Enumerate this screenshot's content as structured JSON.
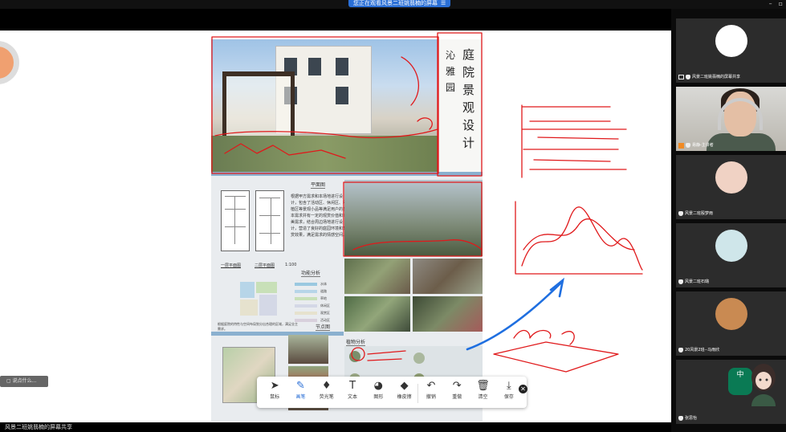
{
  "banner": {
    "text": "您正在观看风景二班姚翡楠的屏幕",
    "menu": "☰"
  },
  "window": {
    "minimize": "–",
    "restore": "▫"
  },
  "stage": {
    "comment": "说点什么...",
    "comment_icon": "comment-icon"
  },
  "poster": {
    "title": "庭院景观设计",
    "subtitle": "沁雅园",
    "sections": {
      "plan": "平面图",
      "function": "功能分析",
      "node": "节点图",
      "plant": "植物分析"
    },
    "plan_labels": [
      "一层平面图",
      "二层平面图"
    ],
    "plan_scale": "1:100",
    "design_text": "根据甲方需求和本场地进行设计，包含了活动区、休闲区、种植区等景观小品等满足用户的基本需求并有一定的观赏价值和审美需求，结合周边场地进行设计，营造了良好的庭园环境和观赏效果，满足需求的情感空间。",
    "legend": [
      {
        "label": "水体",
        "color": "#9ac8e0"
      },
      {
        "label": "道路",
        "color": "#b7d5e8"
      },
      {
        "label": "草地",
        "color": "#c8e0b8"
      },
      {
        "label": "休闲区",
        "color": "#d4d8e6"
      },
      {
        "label": "观赏区",
        "color": "#e6e2ce"
      },
      {
        "label": "活动区",
        "color": "#d8d0dc"
      }
    ],
    "small_note": "根据庭院的特性与空间布局划分出合理的区域，满足业主需求。"
  },
  "toolbar": {
    "tools": [
      {
        "label": "鼠标",
        "icon": "cursor-icon",
        "glyph": "➤"
      },
      {
        "label": "画笔",
        "icon": "pen-icon",
        "glyph": "✎"
      },
      {
        "label": "荧光笔",
        "icon": "highlighter-icon",
        "glyph": "♦"
      },
      {
        "label": "文本",
        "icon": "text-icon",
        "glyph": "T"
      },
      {
        "label": "图形",
        "icon": "shape-icon",
        "glyph": "◕"
      },
      {
        "label": "橡皮擦",
        "icon": "eraser-icon",
        "glyph": "◆"
      },
      {
        "label": "撤销",
        "icon": "undo-icon",
        "glyph": "↶"
      },
      {
        "label": "重做",
        "icon": "redo-icon",
        "glyph": "↷"
      },
      {
        "label": "清空",
        "icon": "trash-icon",
        "glyph": "🗑"
      },
      {
        "label": "保存",
        "icon": "save-icon",
        "glyph": "⤓"
      }
    ],
    "close": "✕"
  },
  "status": "风景二班姚翡楠的屏幕共享",
  "participants": [
    {
      "name": "风景二班姚翡楠的屏幕共享",
      "type": "avatar"
    },
    {
      "name": "易静-主讲者",
      "type": "video"
    },
    {
      "name": "风景二班殷梦雨",
      "type": "avatar"
    },
    {
      "name": "风景二班石璐",
      "type": "avatar"
    },
    {
      "name": "20风景2班--马雨欣",
      "type": "avatar"
    },
    {
      "name": "张思怡",
      "type": "avatar"
    }
  ],
  "ime": {
    "label": "中"
  },
  "colors": {
    "accent": "#2a6fd6",
    "ink": "#e0191b",
    "arrow": "#1f6fe0"
  }
}
